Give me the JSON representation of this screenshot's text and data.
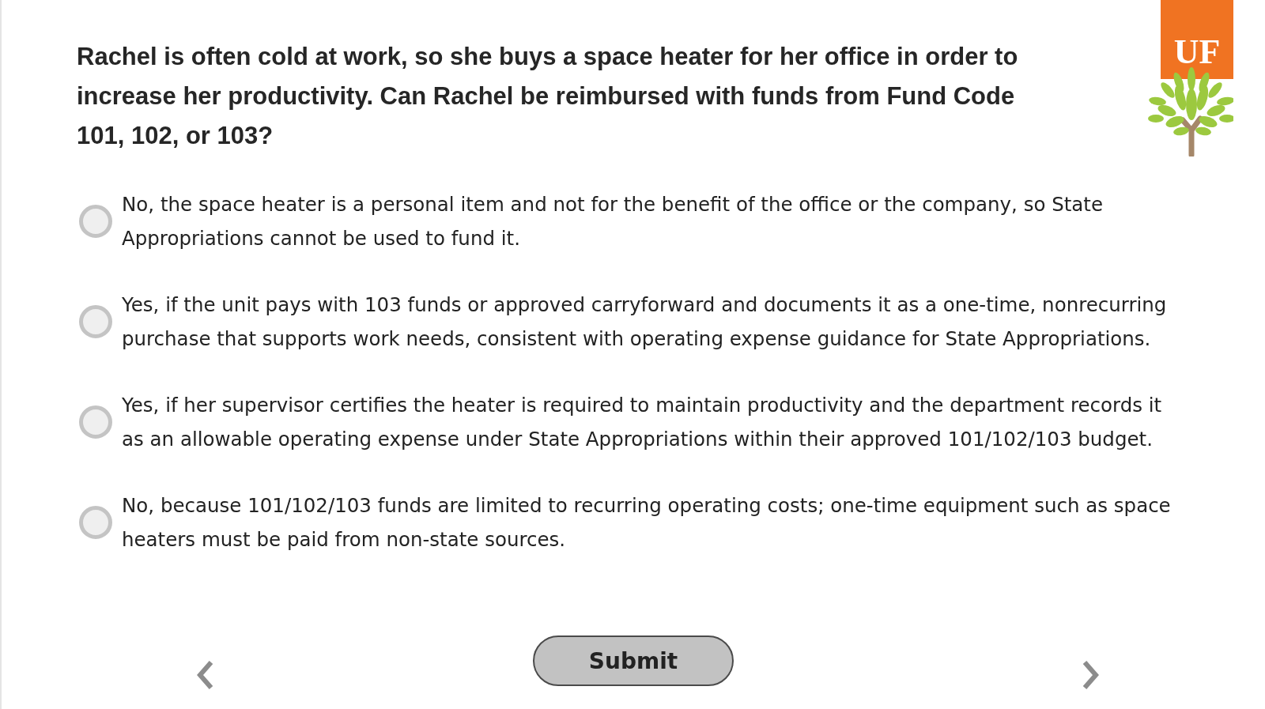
{
  "question": "Rachel is often cold at work, so she buys a space heater for her office in order to increase her productivity. Can Rachel be reimbursed with funds from Fund Code 101, 102, or 103?",
  "options": [
    {
      "label": "No, the space heater is a personal item and not for the benefit of the office or the company, so State Appropriations cannot be used to fund it.",
      "selected": false
    },
    {
      "label": "Yes, if the unit pays with 103 funds or approved carryforward and documents it as a one-time, nonrecurring purchase that supports work needs, consistent with operating expense guidance for State Appropriations.",
      "selected": false
    },
    {
      "label": "Yes, if her supervisor certifies the heater is required to maintain productivity and the department records it as an allowable operating expense under State Appropriations within their approved 101/102/103 budget.",
      "selected": false
    },
    {
      "label": "No, because 101/102/103 funds are limited to recurring operating costs; one-time equipment such as space heaters must be paid from non-state sources.",
      "selected": false
    }
  ],
  "logo": {
    "text": "UF"
  },
  "submit": {
    "label": "Submit"
  }
}
